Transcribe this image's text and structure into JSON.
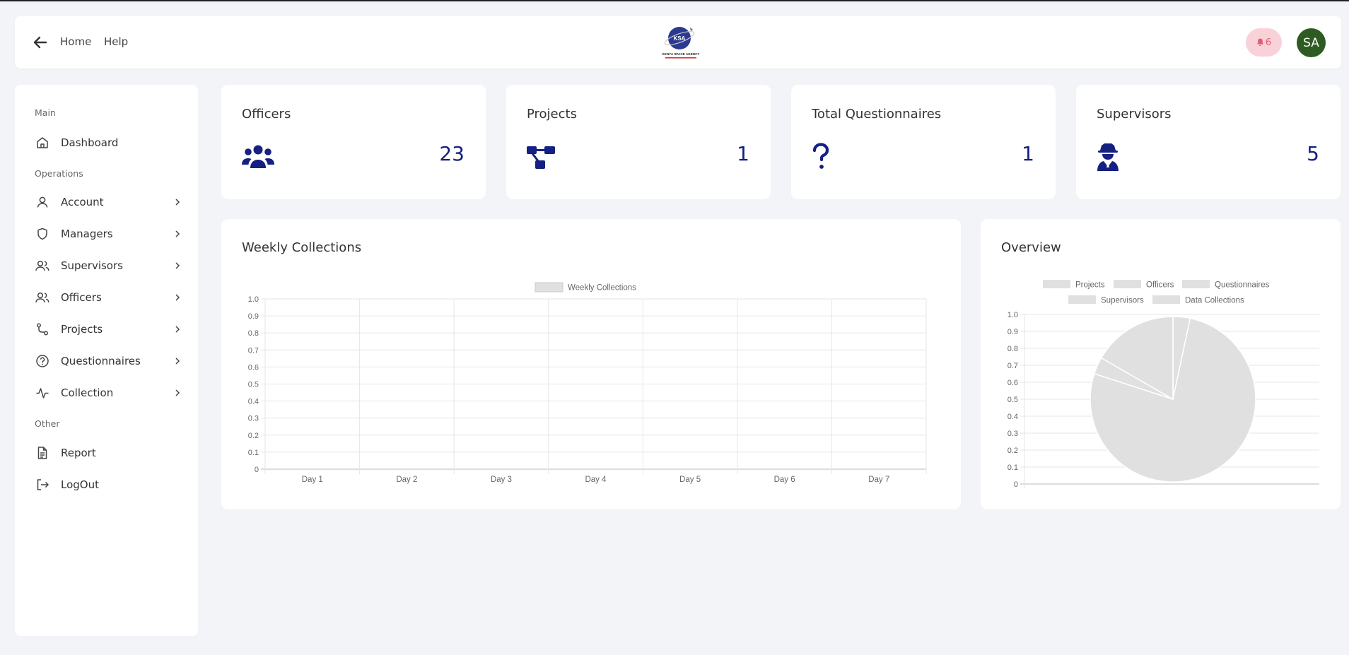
{
  "header": {
    "nav": {
      "home": "Home",
      "help": "Help"
    },
    "logo_text": "KENYA SPACE AGENCY",
    "logo_badge": "KSA",
    "notifications_count": "6",
    "avatar_initials": "SA",
    "avatar_color": "#2e5b22"
  },
  "sidebar": {
    "sections": {
      "main": "Main",
      "operations": "Operations",
      "other": "Other"
    },
    "items": {
      "dashboard": "Dashboard",
      "account": "Account",
      "managers": "Managers",
      "supervisors": "Supervisors",
      "officers": "Officers",
      "projects": "Projects",
      "questionnaires": "Questionnaires",
      "collection": "Collection",
      "report": "Report",
      "logout": "LogOut"
    }
  },
  "stats": {
    "officers": {
      "title": "Officers",
      "value": "23",
      "icon": "users-icon"
    },
    "projects": {
      "title": "Projects",
      "value": "1",
      "icon": "project-diagram-icon"
    },
    "questionnaires": {
      "title": "Total Questionnaires",
      "value": "1",
      "icon": "question-icon"
    },
    "supervisors": {
      "title": "Supervisors",
      "value": "5",
      "icon": "user-secret-icon"
    }
  },
  "colors": {
    "accent": "#142082",
    "notification": "#e35d73",
    "chart_fill": "#e0e0e0"
  },
  "weekly": {
    "title": "Weekly Collections",
    "chart_data": {
      "type": "bar",
      "categories": [
        "Day 1",
        "Day 2",
        "Day 3",
        "Day 4",
        "Day 5",
        "Day 6",
        "Day 7"
      ],
      "series": [
        {
          "name": "Weekly Collections",
          "values": [
            0,
            0,
            0,
            0,
            0,
            0,
            0
          ]
        }
      ],
      "y_ticks": [
        "0",
        "0.1",
        "0.2",
        "0.3",
        "0.4",
        "0.5",
        "0.6",
        "0.7",
        "0.8",
        "0.9",
        "1.0"
      ],
      "ylim": [
        0,
        1
      ],
      "grid": true,
      "legend": "top"
    }
  },
  "overview": {
    "title": "Overview",
    "chart_data": {
      "type": "pie",
      "labels": [
        "Projects",
        "Officers",
        "Questionnaires",
        "Supervisors",
        "Data Collections"
      ],
      "values": [
        1,
        23,
        1,
        5,
        0
      ],
      "y_ticks": [
        "0",
        "0.1",
        "0.2",
        "0.3",
        "0.4",
        "0.5",
        "0.6",
        "0.7",
        "0.8",
        "0.9",
        "1.0"
      ],
      "ylim": [
        0,
        1
      ],
      "grid": true,
      "legend": "top"
    }
  }
}
